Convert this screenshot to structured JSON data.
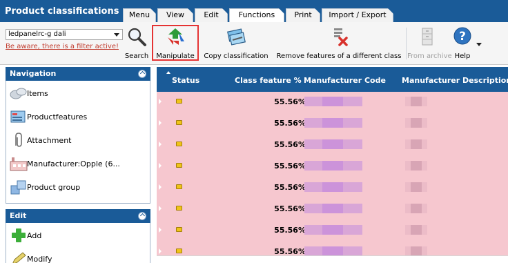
{
  "app": {
    "title": "Product classifications"
  },
  "tabs": [
    {
      "label": "Menu",
      "active": false
    },
    {
      "label": "View",
      "active": false
    },
    {
      "label": "Edit",
      "active": false
    },
    {
      "label": "Functions",
      "active": true
    },
    {
      "label": "Print",
      "active": false
    },
    {
      "label": "Import / Export",
      "active": false
    }
  ],
  "toolbar": {
    "filter": {
      "value": "ledpanelrc-g dali",
      "warning": "Be aware, there is a filter active!"
    },
    "buttons": {
      "search": {
        "label": "Search",
        "icon": "magnifier-icon"
      },
      "manipulate": {
        "label": "Manipulate",
        "icon": "recycle-arrows-icon",
        "highlighted": true
      },
      "copy": {
        "label": "Copy classification",
        "icon": "copy-classification-icon"
      },
      "remove": {
        "label": "Remove features of a different class",
        "icon": "remove-features-icon"
      },
      "archive": {
        "label": "From archive",
        "icon": "archive-cabinet-icon",
        "disabled": true
      },
      "help": {
        "label": "Help",
        "icon": "help-icon"
      }
    },
    "highlight_color": "#e53333"
  },
  "navigation": {
    "title": "Navigation",
    "items": [
      {
        "label": "Items",
        "icon": "items-icon"
      },
      {
        "label": "Productfeatures",
        "icon": "productfeatures-icon"
      },
      {
        "label": "Attachment",
        "icon": "paperclip-icon"
      },
      {
        "label": "Manufacturer:Opple (6...",
        "icon": "factory-icon"
      },
      {
        "label": "Product group",
        "icon": "cubes-icon"
      }
    ]
  },
  "edit": {
    "title": "Edit",
    "items": [
      {
        "label": "Add",
        "icon": "plus-icon"
      },
      {
        "label": "Modify",
        "icon": "pencil-icon"
      }
    ]
  },
  "grid": {
    "columns": [
      "Status",
      "Class feature %",
      "Manufacturer Code",
      "Manufacturer Description"
    ],
    "rows": [
      {
        "status": "yellow",
        "class_feature_pct": "55.56%"
      },
      {
        "status": "yellow",
        "class_feature_pct": "55.56%"
      },
      {
        "status": "yellow",
        "class_feature_pct": "55.56%"
      },
      {
        "status": "yellow",
        "class_feature_pct": "55.56%"
      },
      {
        "status": "yellow",
        "class_feature_pct": "55.56%"
      },
      {
        "status": "yellow",
        "class_feature_pct": "55.56%"
      },
      {
        "status": "yellow",
        "class_feature_pct": "55.56%"
      },
      {
        "status": "yellow",
        "class_feature_pct": "55.56%"
      }
    ],
    "row_color": "#f6c7cf",
    "header_color": "#1a5b98"
  }
}
